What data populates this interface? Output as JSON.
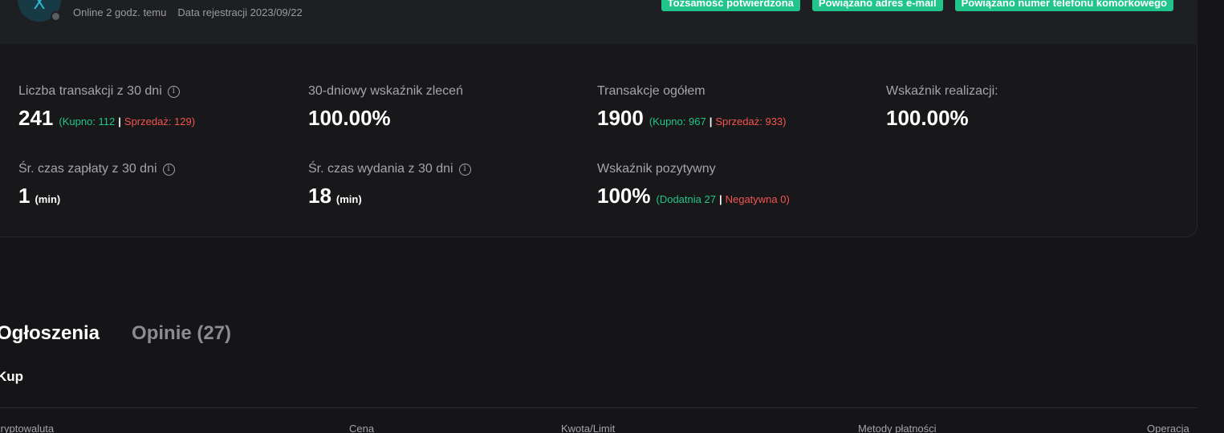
{
  "profile": {
    "avatar_letter": "X",
    "online": "Online 2 godz. temu",
    "registration": "Data rejestracji 2023/09/22",
    "badges": [
      "Tożsamość potwierdzona",
      "Powiązano adres e-mail",
      "Powiązano numer telefonu komórkowego"
    ]
  },
  "stats": {
    "trades30": {
      "label": "Liczba transakcji z 30 dni",
      "value": "241",
      "buy": "(Kupno: 112",
      "sell": "Sprzedaż: 129)"
    },
    "orderRate30": {
      "label": "30-dniowy wskaźnik zleceń",
      "value": "100.00%"
    },
    "totalTrades": {
      "label": "Transakcje ogółem",
      "value": "1900",
      "buy": "(Kupno: 967",
      "sell": "Sprzedaż: 933)"
    },
    "completion": {
      "label": "Wskaźnik realizacji:",
      "value": "100.00%"
    },
    "payTime": {
      "label": "Śr. czas zapłaty z 30 dni",
      "value": "1",
      "unit": "(min)"
    },
    "releaseTime": {
      "label": "Śr. czas wydania z 30 dni",
      "value": "18",
      "unit": "(min)"
    },
    "positive": {
      "label": "Wskaźnik pozytywny",
      "value": "100%",
      "pos": "(Dodatnia 27",
      "neg": "Negatywna 0)"
    }
  },
  "separator": "|",
  "tabs": {
    "ads": "Ogłoszenia",
    "reviews": "Opinie (27)"
  },
  "section": "Kup",
  "table_headers": [
    "Kryptowaluta",
    "Cena",
    "Kwota/Limit",
    "Metody płatności",
    "Operacja"
  ]
}
